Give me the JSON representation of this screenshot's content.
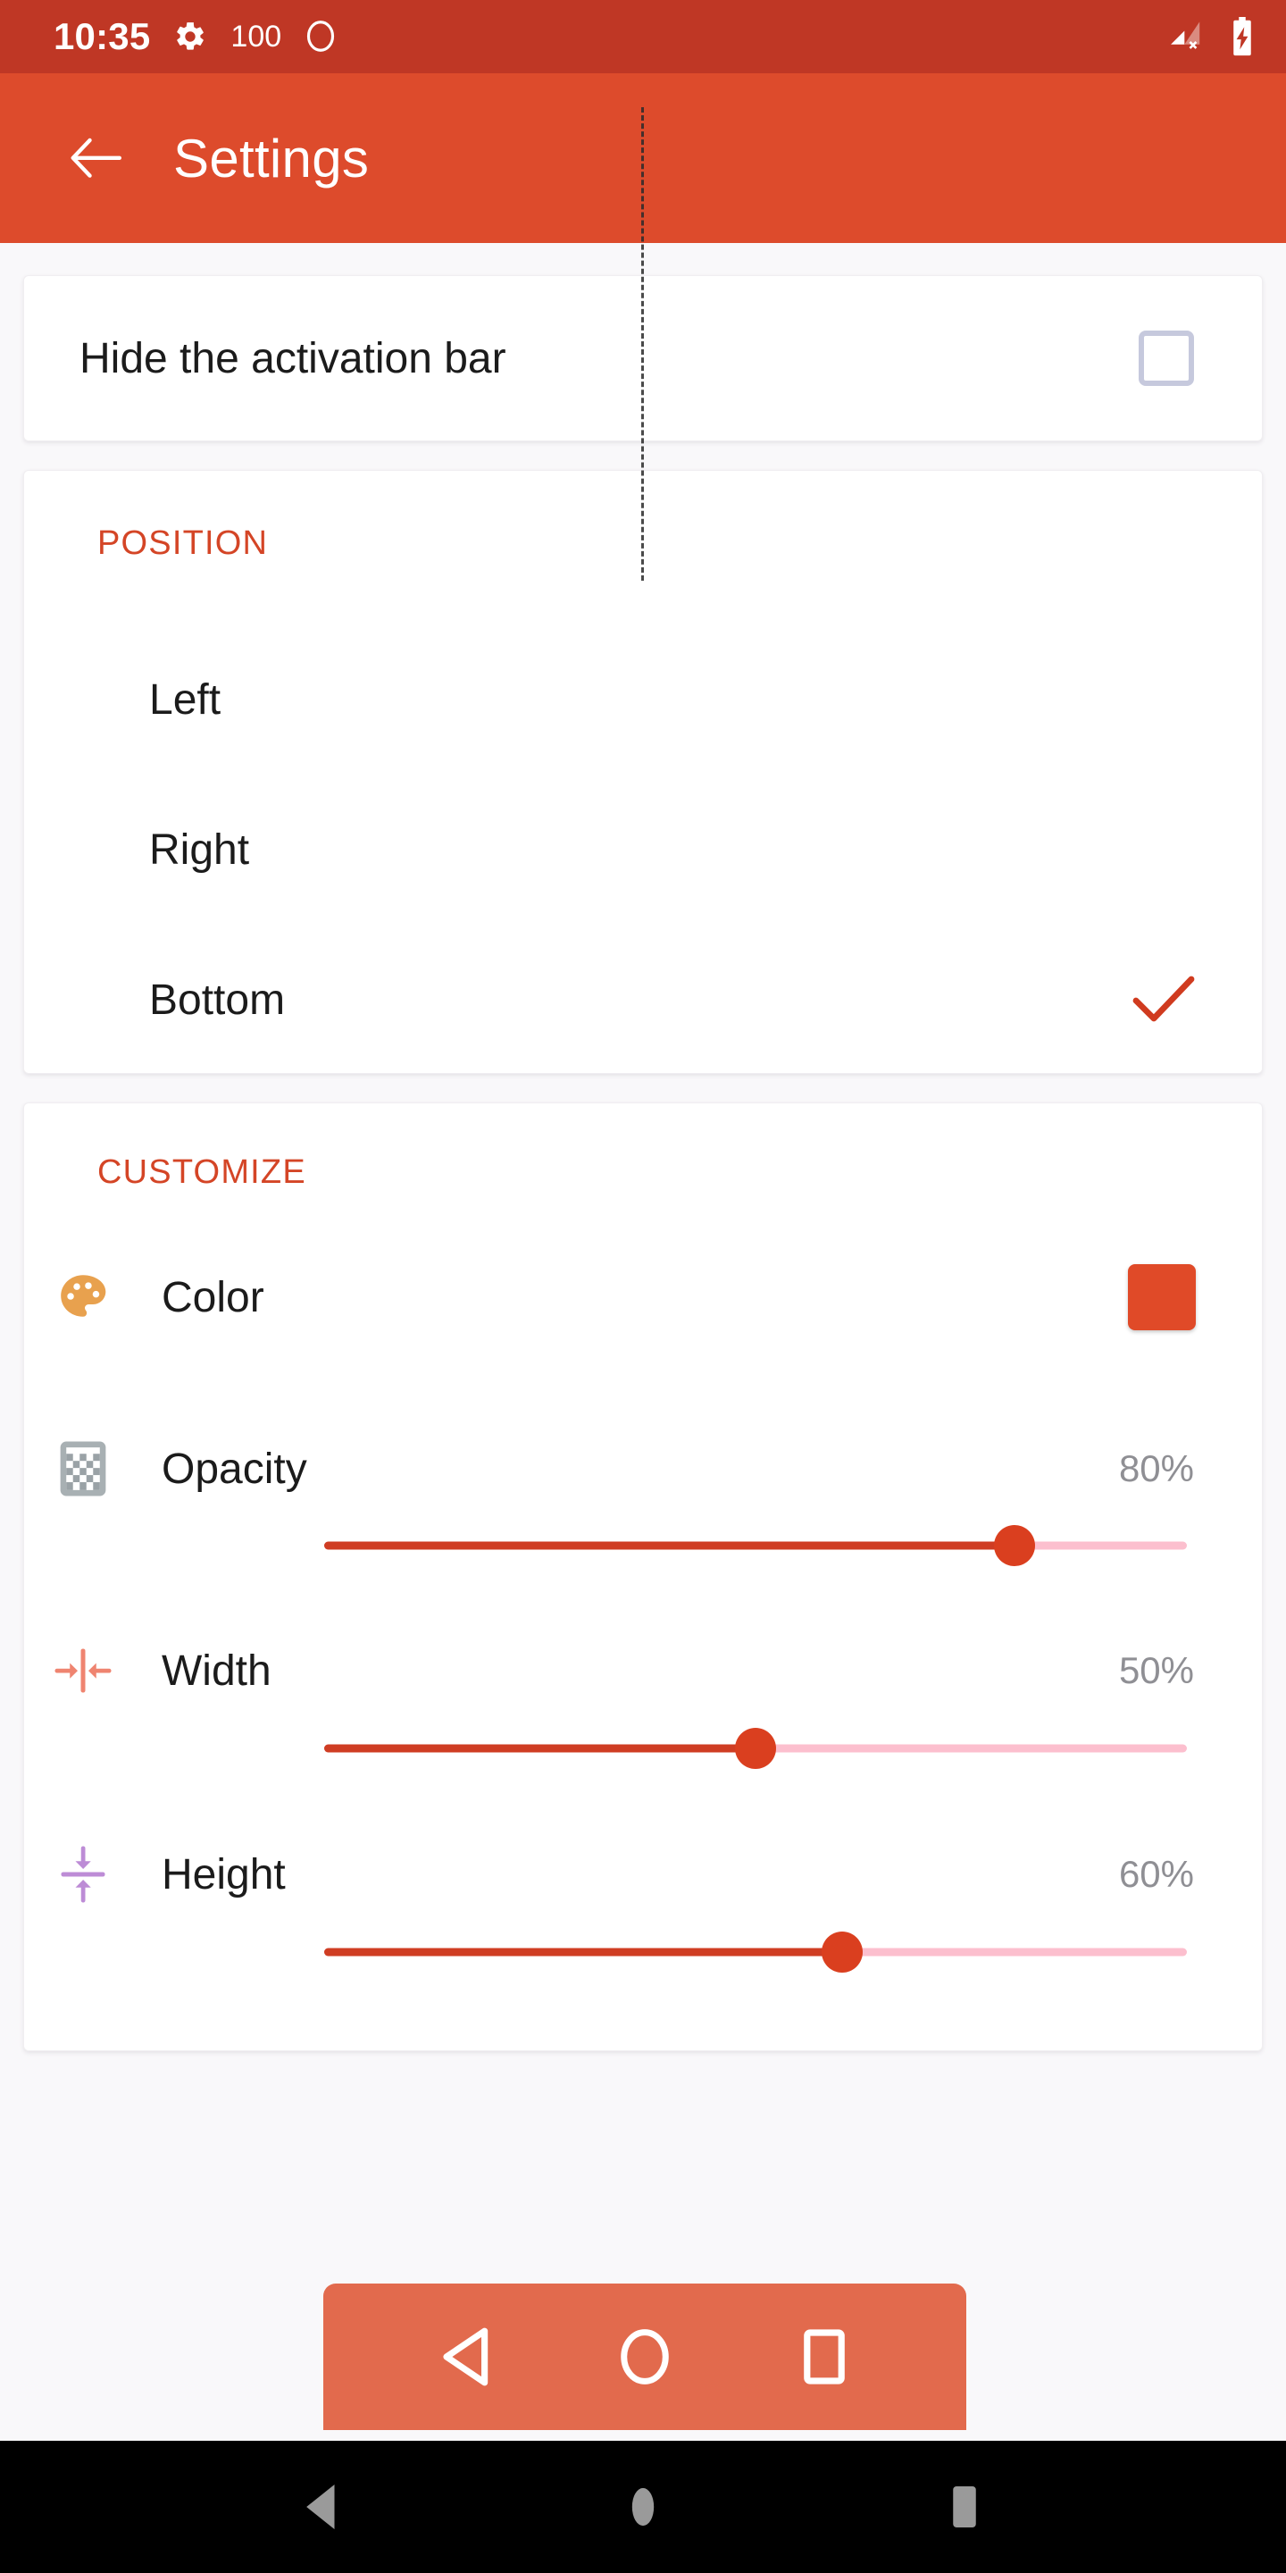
{
  "status_bar": {
    "time": "10:35",
    "battery_number": "100",
    "gear_icon": "gear-icon",
    "circle_icon": "circle-outline-icon",
    "signal_icon": "signal-no-service-icon",
    "battery_icon": "battery-charging-icon",
    "background": "#bf3725"
  },
  "app_bar": {
    "back_icon": "back-arrow-icon",
    "title": "Settings",
    "background": "#dd4b2c"
  },
  "hide_section": {
    "label": "Hide the activation bar",
    "checked": false,
    "checkbox_border": "#c6c9dd"
  },
  "position_section": {
    "header": "POSITION",
    "header_color": "#d44526",
    "selected": "Bottom",
    "check_color": "#d03b1f",
    "options": [
      {
        "label": "Left",
        "selected": false
      },
      {
        "label": "Right",
        "selected": false
      },
      {
        "label": "Bottom",
        "selected": true
      }
    ]
  },
  "customize_section": {
    "header": "CUSTOMIZE",
    "header_color": "#d44526",
    "color_row": {
      "icon": "palette-icon",
      "label": "Color",
      "swatch_color": "#e04a28"
    },
    "sliders": [
      {
        "icon": "checkerboard-icon",
        "label": "Opacity",
        "value": "80%",
        "percent": 80,
        "fill_color": "#cf3d23",
        "track_color": "#fcbfce",
        "thumb_color": "#da3f1f"
      },
      {
        "icon": "width-arrows-icon",
        "label": "Width",
        "value": "50%",
        "percent": 50,
        "fill_color": "#cf3d23",
        "track_color": "#fcbfce",
        "thumb_color": "#da3f1f"
      },
      {
        "icon": "height-arrows-icon",
        "label": "Height",
        "value": "60%",
        "percent": 60,
        "fill_color": "#cf3d23",
        "track_color": "#fcbfce",
        "thumb_color": "#da3f1f"
      }
    ]
  },
  "preview_bar": {
    "background": "#e26a4d",
    "buttons": [
      {
        "icon": "back-triangle-icon"
      },
      {
        "icon": "home-circle-icon"
      },
      {
        "icon": "recents-square-icon"
      }
    ]
  },
  "nav_bar": {
    "background": "#000000",
    "icon_color": "#9a9a9a",
    "buttons": [
      {
        "icon": "nav-back-icon"
      },
      {
        "icon": "nav-home-icon"
      },
      {
        "icon": "nav-recents-icon"
      }
    ]
  }
}
